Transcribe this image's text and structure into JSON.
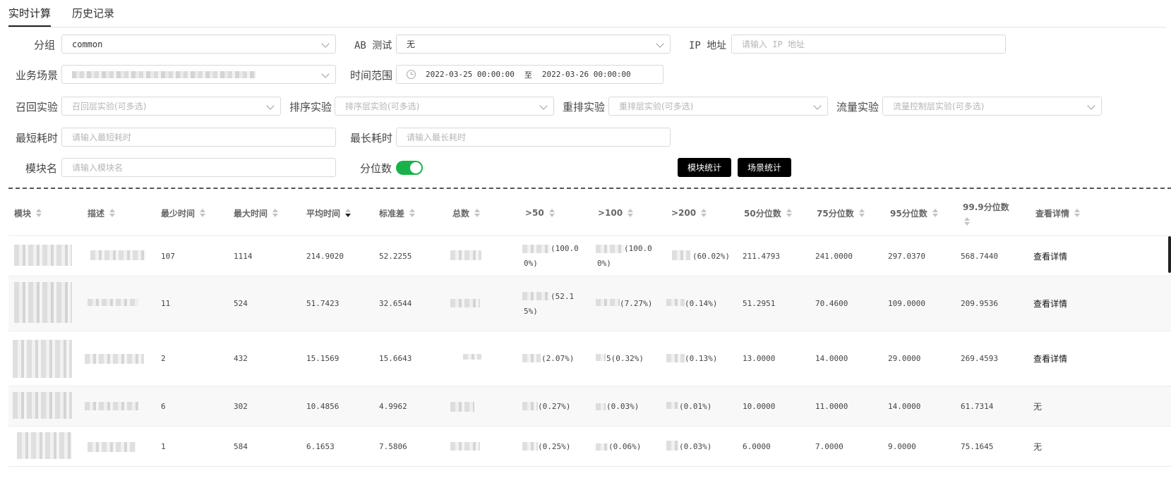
{
  "tabs": [
    {
      "label": "实时计算",
      "active": true
    },
    {
      "label": "历史记录",
      "active": false
    }
  ],
  "form": {
    "group": {
      "label": "分组",
      "value": "common"
    },
    "ab_test": {
      "label": "AB 测试",
      "value": "无"
    },
    "ip": {
      "label": "IP 地址",
      "placeholder": "请输入 IP 地址"
    },
    "scene": {
      "label": "业务场景"
    },
    "time_range": {
      "label": "时间范围",
      "start": "2022-03-25 00:00:00",
      "separator": "至",
      "end": "2022-03-26 00:00:00"
    },
    "recall": {
      "label": "召回实验",
      "placeholder": "召回层实验(可多选)"
    },
    "rank": {
      "label": "排序实验",
      "placeholder": "排序层实验(可多选)"
    },
    "rerank": {
      "label": "重排实验",
      "placeholder": "重排层实验(可多选)"
    },
    "traffic": {
      "label": "流量实验",
      "placeholder": "流量控制层实验(可多选)"
    },
    "min_time": {
      "label": "最短耗时",
      "placeholder": "请输入最短耗时"
    },
    "max_time": {
      "label": "最长耗时",
      "placeholder": "请输入最长耗时"
    },
    "module_name": {
      "label": "模块名",
      "placeholder": "请输入模块名"
    },
    "quantile": {
      "label": "分位数",
      "on": true
    },
    "module_stats_button": "模块统计",
    "scene_stats_button": "场景统计"
  },
  "table": {
    "headers": [
      "模块",
      "描述",
      "最少时间",
      "最大时间",
      "平均时间",
      "标准差",
      "总数",
      ">50",
      ">100",
      ">200",
      "50分位数",
      "75分位数",
      "95分位数",
      "99.9分位数",
      "查看详情"
    ],
    "rows": [
      {
        "min": "107",
        "max": "1114",
        "avg": "214.9020",
        "std": "52.2255",
        "gt50": "(100.00%)",
        "gt100": "(100.00%)",
        "gt200": "(60.02%)",
        "p50": "211.4793",
        "p75": "241.0000",
        "p95": "297.0370",
        "p999": "568.7440",
        "detail": "查看详情"
      },
      {
        "min": "11",
        "max": "524",
        "avg": "51.7423",
        "std": "32.6544",
        "gt50": "(52.15%)",
        "gt100": "(7.27%)",
        "gt200": "(0.14%)",
        "p50": "51.2951",
        "p75": "70.4600",
        "p95": "109.0000",
        "p999": "209.9536",
        "detail": "查看详情"
      },
      {
        "min": "2",
        "max": "432",
        "avg": "15.1569",
        "std": "15.6643",
        "gt50": "(2.07%)",
        "gt100": "5(0.32%)",
        "gt200": "(0.13%)",
        "p50": "13.0000",
        "p75": "14.0000",
        "p95": "29.0000",
        "p999": "269.4593",
        "detail": "查看详情"
      },
      {
        "min": "6",
        "max": "302",
        "avg": "10.4856",
        "std": "4.9962",
        "gt50": "(0.27%)",
        "gt100": "(0.03%)",
        "gt200": "(0.01%)",
        "p50": "10.0000",
        "p75": "11.0000",
        "p95": "14.0000",
        "p999": "61.7314",
        "detail": "无"
      },
      {
        "min": "1",
        "max": "584",
        "avg": "6.1653",
        "std": "7.5806",
        "gt50": "(0.25%)",
        "gt100": "(0.06%)",
        "gt200": "(0.03%)",
        "p50": "6.0000",
        "p75": "7.0000",
        "p95": "9.0000",
        "p999": "75.1645",
        "detail": "无"
      }
    ]
  },
  "colors": {
    "toggle_on": "#17b34a",
    "button_bg": "#000000"
  }
}
